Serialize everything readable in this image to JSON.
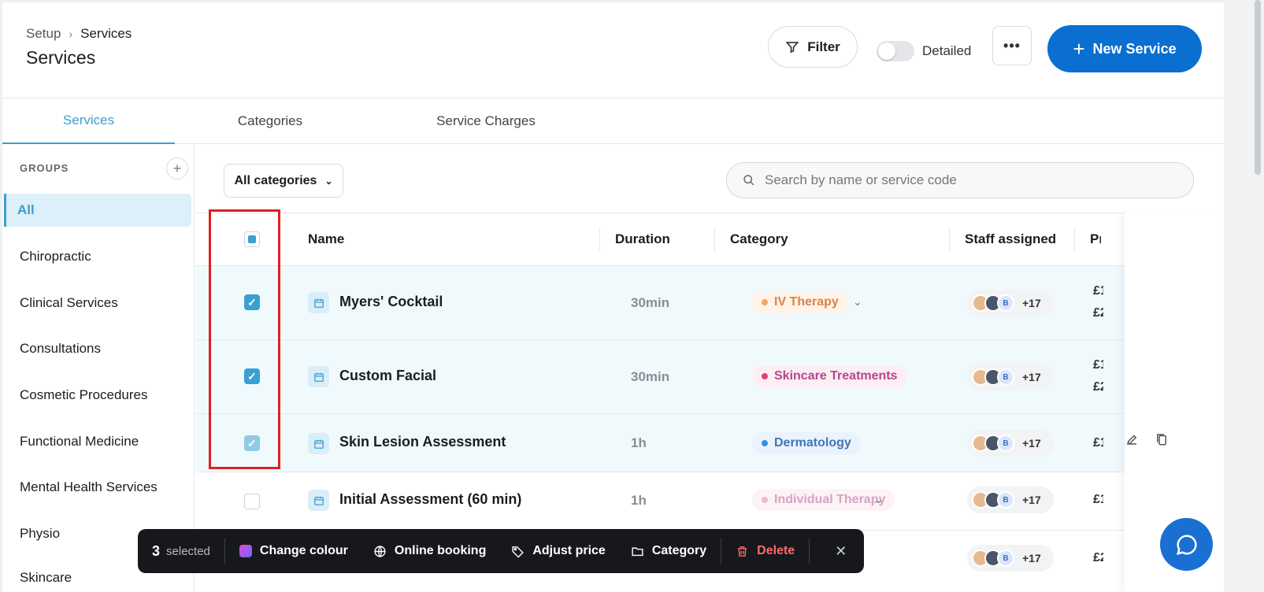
{
  "header": {
    "breadcrumb": [
      "Setup",
      "Services"
    ],
    "title": "Services",
    "filter_label": "Filter",
    "detailed_label": "Detailed",
    "more_label": "•••",
    "new_service_label": "New Service"
  },
  "tabs": [
    "Services",
    "Categories",
    "Service Charges"
  ],
  "sidebar": {
    "groups_heading": "GROUPS",
    "items": [
      "All",
      "Chiropractic",
      "Clinical Services",
      "Consultations",
      "Cosmetic Procedures",
      "Functional Medicine",
      "Mental Health Services",
      "Physio",
      "Skincare"
    ]
  },
  "filters": {
    "category_select": "All categories",
    "search_placeholder": "Search by name or service code"
  },
  "table": {
    "columns": [
      "Name",
      "Duration",
      "Category",
      "Staff assigned",
      "Pr"
    ],
    "rows": [
      {
        "name": "Myers' Cocktail",
        "duration": "30min",
        "category": "IV Therapy",
        "category_color": "#f0a860",
        "category_text": "#d98345",
        "category_bg": "#fff3ea",
        "staff_more": "+17",
        "staff_initial": "B",
        "prices": [
          "£1",
          "£2"
        ],
        "selected": true
      },
      {
        "name": "Custom Facial",
        "duration": "30min",
        "category": "Skincare Treatments",
        "category_color": "#e0407a",
        "category_text": "#b3478f",
        "category_bg": "#fdeef4",
        "staff_more": "+17",
        "staff_initial": "B",
        "prices": [
          "£1",
          "£2"
        ],
        "selected": true
      },
      {
        "name": "Skin Lesion Assessment",
        "duration": "1h",
        "category": "Dermatology",
        "category_color": "#3a8de0",
        "category_text": "#3f77b8",
        "category_bg": "#eaf3fd",
        "staff_more": "+17",
        "staff_initial": "B",
        "prices": [
          "£1"
        ],
        "selected": true
      },
      {
        "name": "Initial Assessment (60 min)",
        "duration": "1h",
        "category": "Individual Therapy",
        "category_color": "#f2b6cf",
        "category_text": "#d7a3c3",
        "category_bg": "#fdf3f7",
        "staff_more": "+17",
        "staff_initial": "B",
        "prices": [
          "£1"
        ],
        "selected": false
      },
      {
        "name": "",
        "duration": "",
        "category": "",
        "category_color": "",
        "category_text": "",
        "category_bg": "",
        "staff_more": "+17",
        "staff_initial": "B",
        "prices": [
          "£2"
        ],
        "selected": false
      }
    ]
  },
  "bulk_bar": {
    "count": "3",
    "selected_label": "selected",
    "change_colour": "Change colour",
    "online_booking": "Online booking",
    "adjust_price": "Adjust price",
    "category": "Category",
    "delete": "Delete"
  },
  "colors": {
    "accent": "#3a9fd1",
    "primary_button": "#0a6fd1",
    "highlight_box": "#e02020",
    "delete": "#ff6b6b"
  }
}
